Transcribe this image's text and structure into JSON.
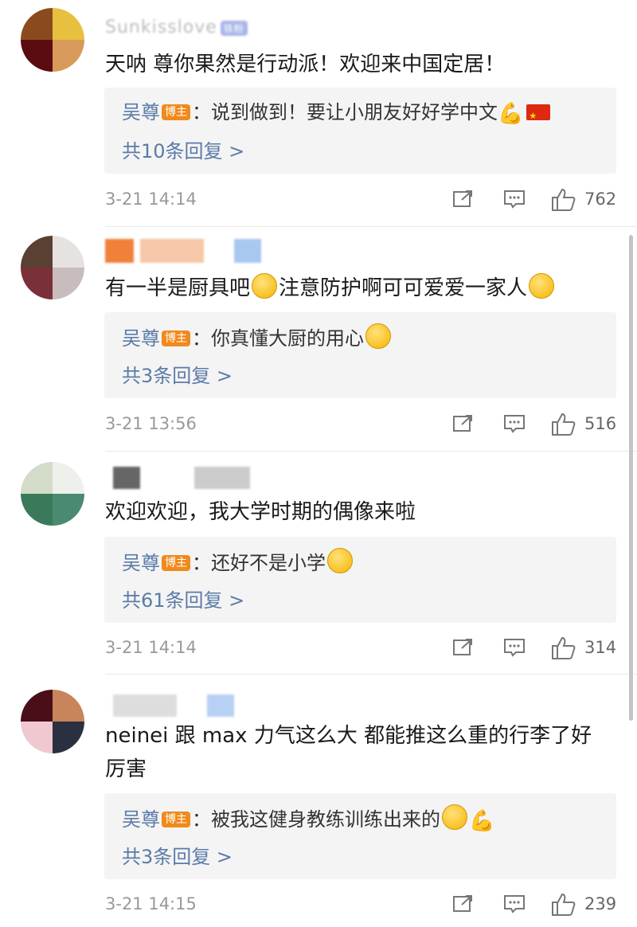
{
  "comments": [
    {
      "username": "Sunkisslove",
      "user_badge": "铁粉",
      "text": "天呐 尊你果然是行动派！欢迎来中国定居！",
      "reply": {
        "author": "吴尊",
        "badge": "博主",
        "text": "：说到做到！要让小朋友好好学中文",
        "count_label": "共10条回复 >"
      },
      "time": "3-21 14:14",
      "likes": "762"
    },
    {
      "username": "",
      "text_before": "有一半是厨具吧",
      "text_middle": "注意防护啊可可爱爱一家人",
      "reply": {
        "author": "吴尊",
        "badge": "博主",
        "text": "：你真懂大厨的用心",
        "count_label": "共3条回复 >"
      },
      "time": "3-21 13:56",
      "likes": "516"
    },
    {
      "username": "",
      "text": "欢迎欢迎，我大学时期的偶像来啦",
      "reply": {
        "author": "吴尊",
        "badge": "博主",
        "text": "：还好不是小学",
        "count_label": "共61条回复 >"
      },
      "time": "3-21 14:14",
      "likes": "314"
    },
    {
      "username": "",
      "text": "neinei 跟 max 力气这么大  都能推这么重的行李了好厉害",
      "reply": {
        "author": "吴尊",
        "badge": "博主",
        "text": "：被我这健身教练训练出来的",
        "count_label": "共3条回复 >"
      },
      "time": "3-21 14:15",
      "likes": "239"
    }
  ],
  "icons": {
    "forward": "forward-icon",
    "comment": "comment-icon",
    "like": "thumbs-up-icon",
    "muscle": "flexed-biceps-icon",
    "flag": "china-flag-icon"
  },
  "colors": {
    "reply_author": "#5b7ba8",
    "host_badge": "#f08a1c",
    "reply_bg": "#f4f4f4",
    "meta_text": "#999999"
  }
}
